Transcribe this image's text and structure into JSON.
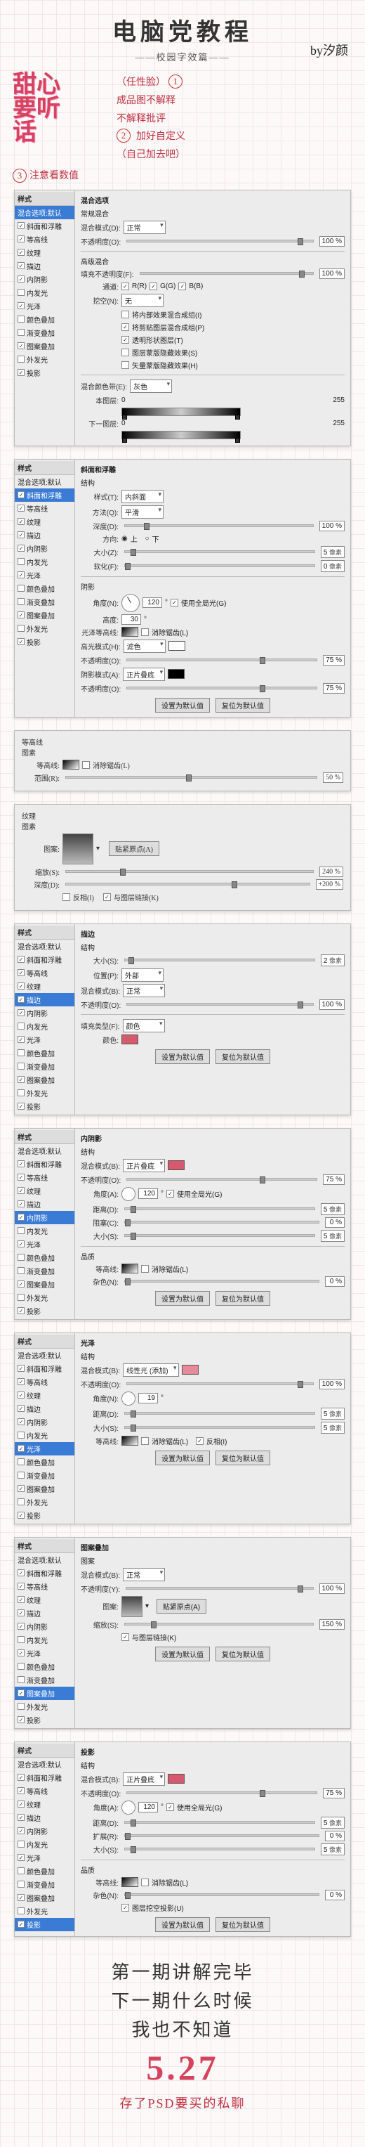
{
  "header": {
    "title": "电脑党教程",
    "subtitle": "——校园字效篇——",
    "byline": "by汐颜"
  },
  "hero": {
    "art_l1": "甜心",
    "art_l2": "要听",
    "art_l3": "话",
    "note1_tag": "（任性脸）",
    "note1a": "成品图不解释",
    "note1b": "不解释批评",
    "note2a": "加好自定义",
    "note2b": "（自己加去吧）",
    "note3": "注意看数值"
  },
  "layers": {
    "header": "样式",
    "opts_default": "混合选项:默认",
    "items": [
      {
        "label": "斜面和浮雕",
        "checked": true
      },
      {
        "label": "等高线",
        "checked": true
      },
      {
        "label": "纹理",
        "checked": true
      },
      {
        "label": "描边",
        "checked": true
      },
      {
        "label": "内阴影",
        "checked": true
      },
      {
        "label": "内发光",
        "checked": false
      },
      {
        "label": "光泽",
        "checked": true
      },
      {
        "label": "颜色叠加",
        "checked": false
      },
      {
        "label": "渐变叠加",
        "checked": false
      },
      {
        "label": "图案叠加",
        "checked": true
      },
      {
        "label": "外发光",
        "checked": false
      },
      {
        "label": "投影",
        "checked": true
      }
    ]
  },
  "p1": {
    "section": "混合选项",
    "sub1": "常规混合",
    "blend_lbl": "混合模式(D):",
    "blend": "正常",
    "opacity_lbl": "不透明度(O):",
    "opacity": 100,
    "sub2": "高级混合",
    "fill_lbl": "填充不透明度(F):",
    "fill": 100,
    "channels_lbl": "通道:",
    "chR": "R(R)",
    "chG": "G(G)",
    "chB": "B(B)",
    "knockout_lbl": "挖空(N):",
    "knockout": "无",
    "c1": "将内部效果混合成组(I)",
    "c2": "将剪贴图层混合成组(P)",
    "c3": "透明形状图层(T)",
    "c4": "图层蒙版隐藏效果(S)",
    "c5": "矢量蒙版隐藏效果(H)",
    "blendif_lbl": "混合颜色带(E):",
    "blendif": "灰色",
    "this_lbl": "本图层:",
    "v0": 0,
    "v255": 255,
    "under_lbl": "下一图层:"
  },
  "p2": {
    "section": "斜面和浮雕",
    "struct": "结构",
    "style_lbl": "样式(T):",
    "style": "内斜面",
    "tech_lbl": "方法(Q):",
    "tech": "平滑",
    "depth_lbl": "深度(D):",
    "depth": 100,
    "dir_lbl": "方向:",
    "dir_up": "上",
    "dir_down": "下",
    "size_lbl": "大小(Z):",
    "size": 5,
    "soft_lbl": "软化(F):",
    "soft": 0,
    "shade": "阴影",
    "angle_lbl": "角度(N):",
    "angle": 120,
    "global": "使用全局光(G)",
    "alt_lbl": "高度:",
    "alt": 30,
    "gloss_lbl": "光泽等高线:",
    "aa": "消除锯齿(L)",
    "hmode_lbl": "高光模式(H):",
    "hmode": "滤色",
    "hop": 75,
    "smode_lbl": "阴影模式(A):",
    "smode": "正片叠底",
    "sop": 75,
    "btn1": "设置为默认值",
    "btn2": "复位为默认值"
  },
  "p3": {
    "section": "等高线",
    "sub": "图素",
    "contour_lbl": "等高线:",
    "aa": "消除锯齿(L)",
    "range_lbl": "范围(R):",
    "range": 50
  },
  "p4": {
    "section": "纹理",
    "sub": "图素",
    "pattern_lbl": "图案:",
    "snap": "贴紧原点(A)",
    "scale_lbl": "缩放(S):",
    "scale": 240,
    "depth_lbl": "深度(D):",
    "depth": "+200",
    "invert": "反相(I)",
    "link": "与图层链接(K)"
  },
  "p5": {
    "section": "描边",
    "struct": "结构",
    "size_lbl": "大小(S):",
    "size": 2,
    "pos_lbl": "位置(P):",
    "pos": "外部",
    "blend_lbl": "混合模式(B):",
    "blend": "正常",
    "op_lbl": "不透明度(O):",
    "op": 100,
    "ftype_lbl": "填充类型(F):",
    "ftype": "颜色",
    "color_lbl": "颜色:",
    "color": "#d6596e",
    "btn1": "设置为默认值",
    "btn2": "复位为默认值"
  },
  "p6": {
    "section": "内阴影",
    "struct": "结构",
    "blend_lbl": "混合模式(B):",
    "blend": "正片叠底",
    "color": "#d6596e",
    "op_lbl": "不透明度(O):",
    "op": 75,
    "angle_lbl": "角度(A):",
    "angle": 120,
    "global": "使用全局光(G)",
    "dist_lbl": "距离(D):",
    "dist": 5,
    "choke_lbl": "阻塞(C):",
    "choke": 0,
    "size_lbl": "大小(S):",
    "size": 5,
    "qual": "品质",
    "contour_lbl": "等高线:",
    "aa": "消除锯齿(L)",
    "noise_lbl": "杂色(N):",
    "noise": 0,
    "btn1": "设置为默认值",
    "btn2": "复位为默认值"
  },
  "p7": {
    "section": "光泽",
    "struct": "结构",
    "blend_lbl": "混合模式(B):",
    "blend": "线性光 (添加)",
    "color": "#e98a9a",
    "op_lbl": "不透明度(O):",
    "op": 100,
    "angle_lbl": "角度(N):",
    "angle": 19,
    "dist_lbl": "距离(D):",
    "dist": 5,
    "size_lbl": "大小(S):",
    "size": 5,
    "contour_lbl": "等高线:",
    "aa": "消除锯齿(L)",
    "inv": "反相(I)",
    "btn1": "设置为默认值",
    "btn2": "复位为默认值"
  },
  "p8": {
    "section": "图案叠加",
    "sub": "图案",
    "blend_lbl": "混合模式(B):",
    "blend": "正常",
    "op_lbl": "不透明度(Y):",
    "op": 100,
    "pattern_lbl": "图案:",
    "snap": "贴紧原点(A)",
    "scale_lbl": "缩放(S):",
    "scale": 150,
    "link": "与图层链接(K)",
    "btn1": "设置为默认值",
    "btn2": "复位为默认值"
  },
  "p9": {
    "section": "投影",
    "struct": "结构",
    "blend_lbl": "混合模式(B):",
    "blend": "正片叠底",
    "color": "#d6596e",
    "op_lbl": "不透明度(O):",
    "op": 75,
    "angle_lbl": "角度(A):",
    "angle": 120,
    "global": "使用全局光(G)",
    "dist_lbl": "距离(D):",
    "dist": 5,
    "spread_lbl": "扩展(R):",
    "spread": 0,
    "size_lbl": "大小(S):",
    "size": 5,
    "qual": "品质",
    "contour_lbl": "等高线:",
    "aa": "消除锯齿(L)",
    "noise_lbl": "杂色(N):",
    "noise": 0,
    "knock": "图层挖空投影(U)",
    "btn1": "设置为默认值",
    "btn2": "复位为默认值"
  },
  "footer": {
    "l1": "第一期讲解完毕",
    "l2": "下一期什么时候",
    "l3": "我也不知道",
    "date": "5.27",
    "psd": "存了PSD要买的私聊"
  }
}
